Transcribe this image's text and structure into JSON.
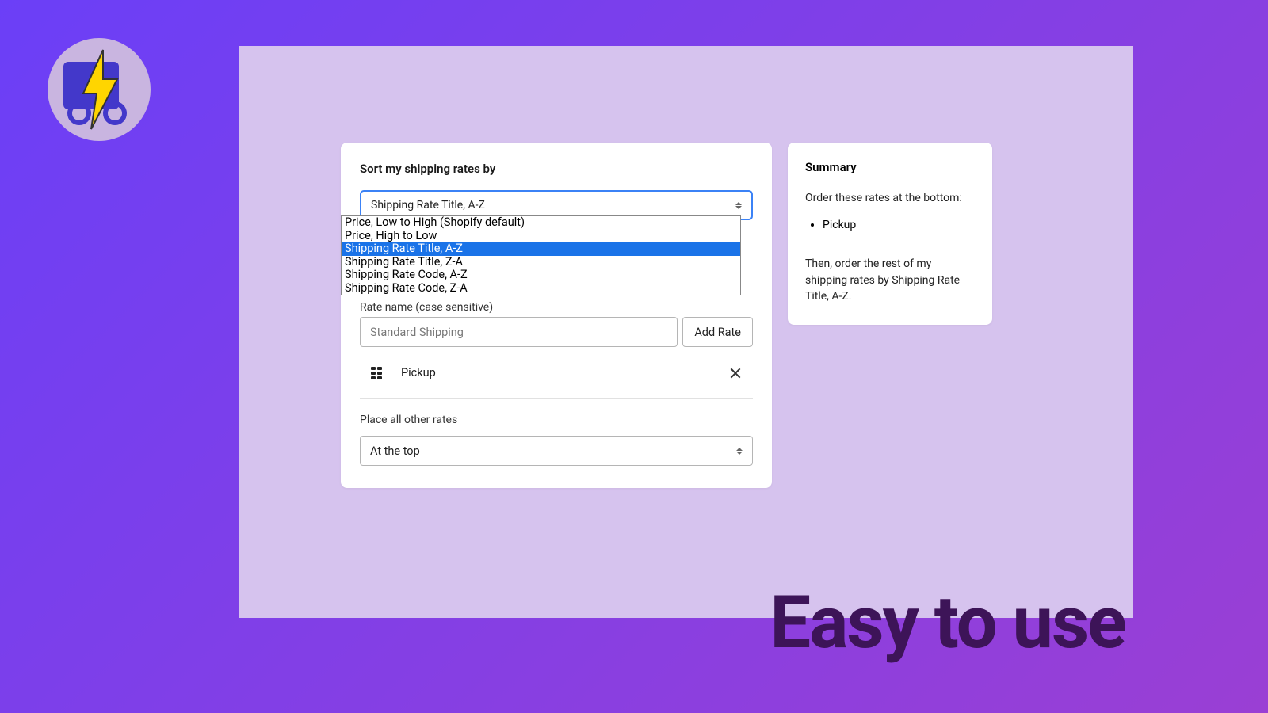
{
  "sort": {
    "label": "Sort my shipping rates by",
    "selected": "Shipping Rate Title, A-Z",
    "options": [
      "Price, Low to High (Shopify default)",
      "Price, High to Low",
      "Shipping Rate Title, A-Z",
      "Shipping Rate Title, Z-A",
      "Shipping Rate Code, A-Z",
      "Shipping Rate Code, Z-A"
    ]
  },
  "rate_input": {
    "label": "Rate name (case sensitive)",
    "placeholder": "Standard Shipping",
    "add_button": "Add Rate"
  },
  "rates": {
    "item0": "Pickup"
  },
  "placement": {
    "label": "Place all other rates",
    "selected": "At the top"
  },
  "summary": {
    "title": "Summary",
    "intro": "Order these rates at the bottom:",
    "item0": "Pickup",
    "then": "Then, order the rest of my shipping rates by Shipping Rate Title, A-Z."
  },
  "tagline": "Easy to use"
}
